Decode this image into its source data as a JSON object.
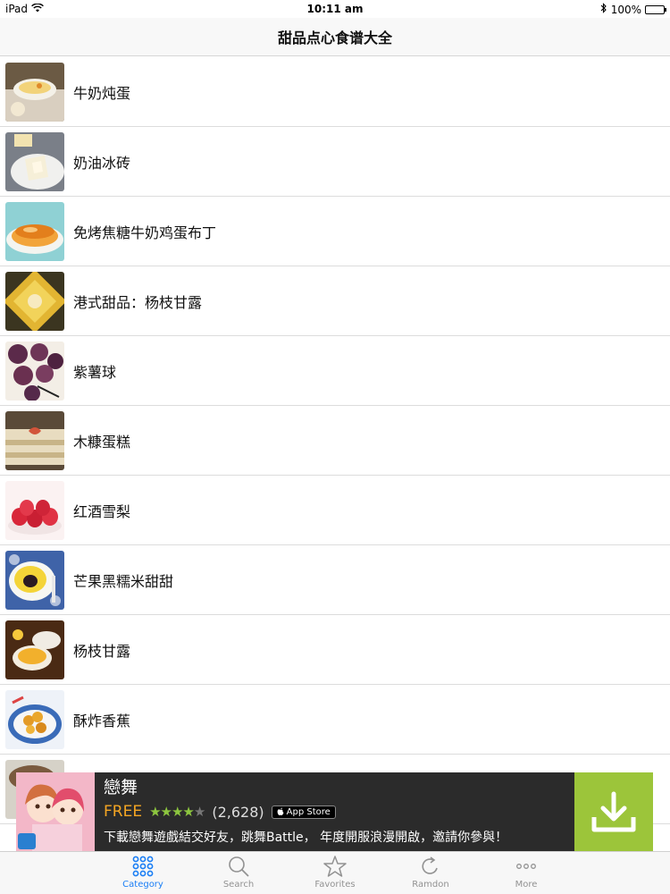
{
  "status_bar": {
    "device": "iPad",
    "time": "10:11 am",
    "battery": "100%"
  },
  "nav": {
    "title": "甜品点心食谱大全"
  },
  "recipes": [
    {
      "name": "牛奶炖蛋"
    },
    {
      "name": "奶油冰砖"
    },
    {
      "name": "免烤焦糖牛奶鸡蛋布丁"
    },
    {
      "name": "港式甜品：杨枝甘露"
    },
    {
      "name": "紫薯球"
    },
    {
      "name": "木糠蛋糕"
    },
    {
      "name": "红酒雪梨"
    },
    {
      "name": "芒果黑糯米甜甜"
    },
    {
      "name": "杨枝甘露"
    },
    {
      "name": "酥炸香蕉"
    }
  ],
  "ad": {
    "title": "戀舞",
    "price": "FREE",
    "rating": 4,
    "rating_count": "(2,628)",
    "store_badge": "App Store",
    "description": "下載戀舞遊戲結交好友，跳舞Battle， 年度開服浪漫開啟，邀請你參與！",
    "download_color": "#9cc53a"
  },
  "tabs": [
    {
      "label": "Category",
      "icon": "grid-icon",
      "active": true
    },
    {
      "label": "Search",
      "icon": "search-icon",
      "active": false
    },
    {
      "label": "Favorites",
      "icon": "star-icon",
      "active": false
    },
    {
      "label": "Ramdon",
      "icon": "refresh-icon",
      "active": false
    },
    {
      "label": "More",
      "icon": "more-icon",
      "active": false
    }
  ],
  "colors": {
    "accent": "#1a7ef5",
    "inactive_tab": "#929292"
  }
}
